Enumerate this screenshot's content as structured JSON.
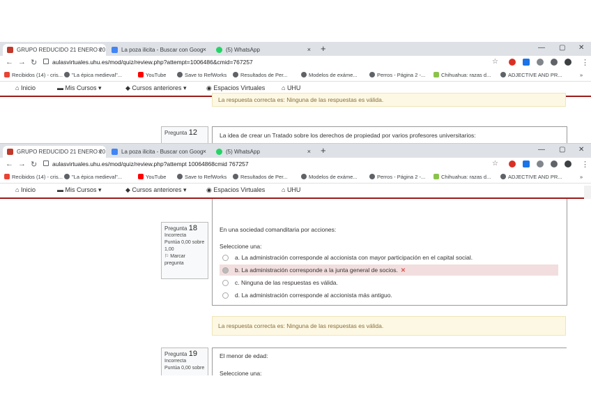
{
  "browser": {
    "tabs": [
      {
        "title": "GRUPO REDUCIDO 21 ENERO 20",
        "close": "×",
        "favicon_color": "#c0392b"
      },
      {
        "title": "La poza ilicita - Buscar con Goog",
        "close": "×",
        "favicon_color": "#4285f4"
      },
      {
        "title": "(5) WhatsApp",
        "close": "×",
        "favicon_color": "#25d366"
      }
    ],
    "new_tab": "+",
    "url_top": "aulasvirtuales.uhu.es/mod/quiz/review.php?attempt=1006486&cmid=767257",
    "url_bottom": "aulasvirtuales.uhu.es/mod/quiz/review.php?attempt 10064868cmid 767257",
    "bookmarks": [
      {
        "label": "Recibidos (14) - cris...",
        "color": "#ea4335"
      },
      {
        "label": "\"La épica medieval\"...",
        "color": "#5f6368"
      },
      {
        "label": "YouTube",
        "color": "#ff0000"
      },
      {
        "label": "Save to RefWorks",
        "color": "#5f6368"
      },
      {
        "label": "Resultados de Per...",
        "color": "#5f6368"
      },
      {
        "label": "Modelos de exáme...",
        "color": "#5f6368"
      },
      {
        "label": "Perros - Página 2 -...",
        "color": "#5f6368"
      },
      {
        "label": "Chihuahua: razas d...",
        "color": "#8bc34a"
      },
      {
        "label": "ADJECTIVE AND PR...",
        "color": "#5f6368"
      }
    ],
    "bookmarks_more": "»",
    "window_controls": [
      "—",
      "▢",
      "✕"
    ]
  },
  "site_nav": {
    "home": "Inicio",
    "my_courses": "Mis Cursos",
    "past_courses": "Cursos anteriores",
    "virtual_spaces": "Espacios Virtuales",
    "uhu": "UHU"
  },
  "top_snippet": {
    "feedback": "La respuesta correcta es: Ninguna de las respuestas es válida.",
    "question_label": "Pregunta",
    "question_number": "12",
    "question_text": "La idea de crear un Tratado sobre los derechos de propiedad por varios profesores universitarios:"
  },
  "question18": {
    "label": "Pregunta",
    "number": "18",
    "status": "Incorrecta",
    "score": "Puntúa 0,00 sobre 1,00",
    "flag": "Marcar pregunta",
    "text": "En una sociedad comanditaria por acciones:",
    "prompt": "Seleccione una:",
    "options": [
      "a. La administración corresponde al accionista con mayor participación en el capital social.",
      "b. La administración corresponde a la junta general de socios.",
      "c. Ninguna de las respuestas es válida.",
      "d. La administración corresponde al accionista más antiguo."
    ],
    "feedback": "La respuesta correcta es: Ninguna de las respuestas es válida."
  },
  "question19": {
    "label": "Pregunta",
    "number": "19",
    "status": "Incorrecta",
    "score": "Puntúa 0,00 sobre",
    "text": "El menor de edad:",
    "prompt": "Seleccione una:"
  },
  "colors": {
    "accent": "#9b1b1b",
    "feedback_bg": "#fcf8e3",
    "wrong_bg": "#f2dede"
  }
}
